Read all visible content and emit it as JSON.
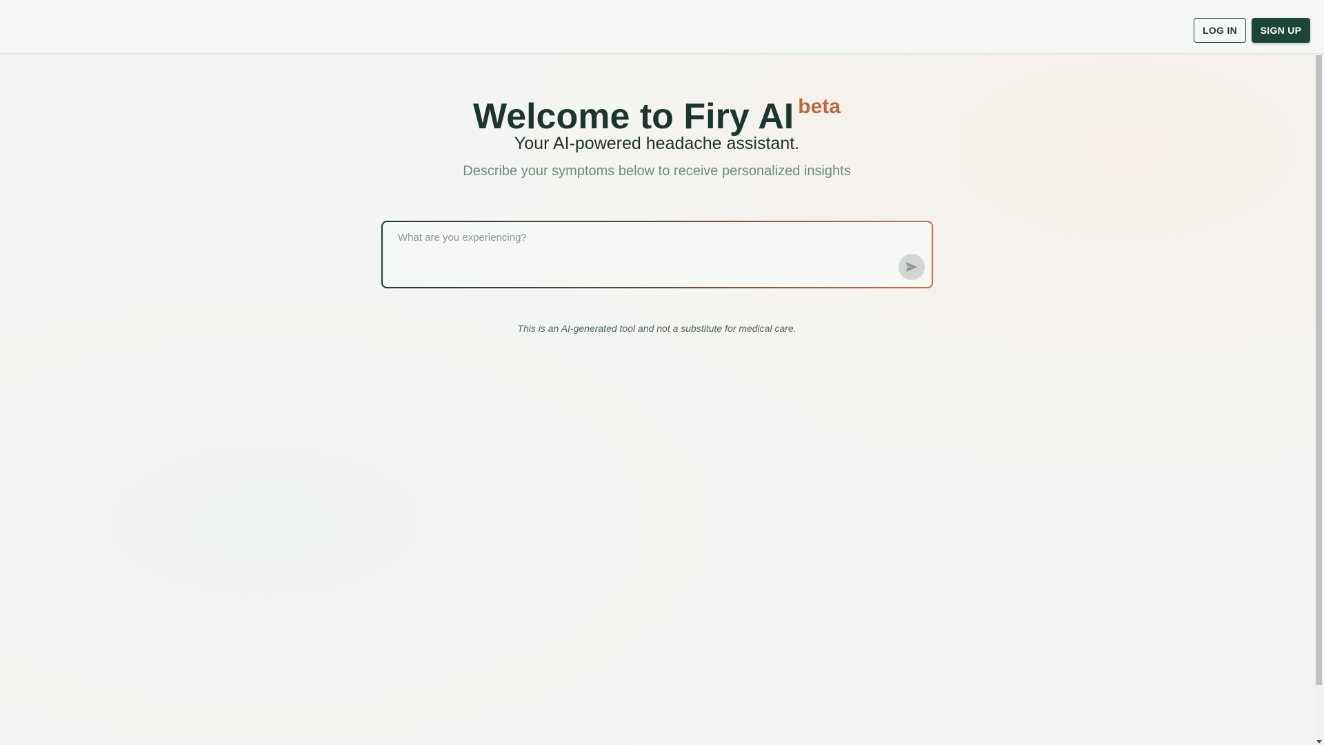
{
  "header": {
    "login_label": "LOG IN",
    "signup_label": "SIGN UP"
  },
  "hero": {
    "title": "Welcome to Firy AI",
    "badge": "beta",
    "subtitle": "Your AI-powered headache assistant.",
    "description": "Describe your symptoms below to receive personalized insights"
  },
  "symptom_input": {
    "placeholder": "What are you experiencing?",
    "value": "",
    "send_icon": "send-icon"
  },
  "disclaimer": "This is an AI-generated tool and not a substitute for medical care.",
  "colors": {
    "brand_dark": "#1d4538",
    "accent_orange": "#b86a40",
    "muted_text": "#6d8a80"
  }
}
